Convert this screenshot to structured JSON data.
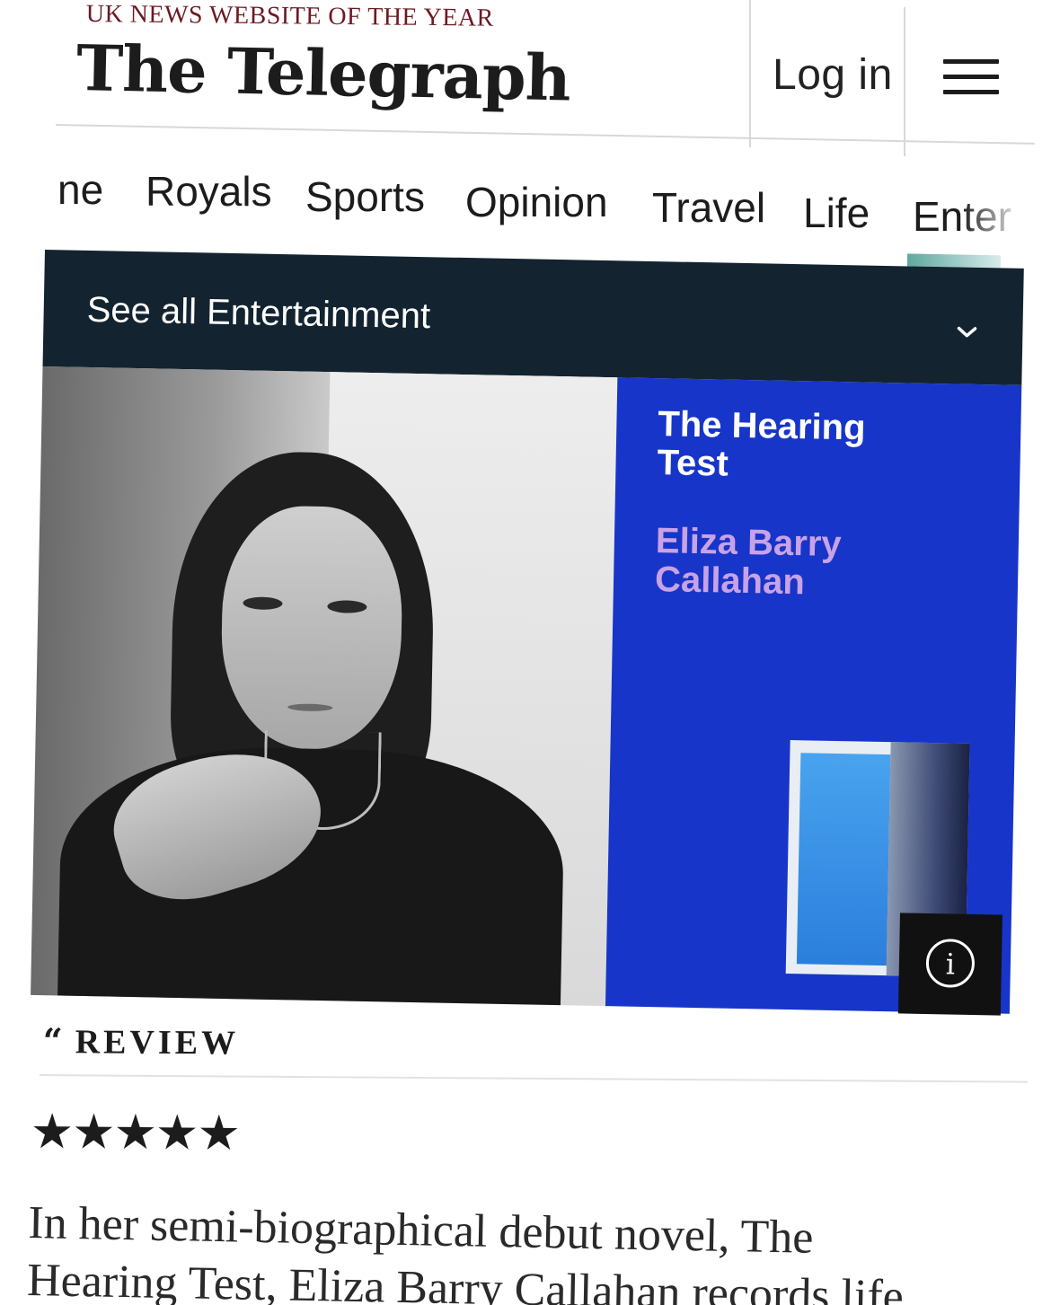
{
  "header": {
    "tagline": "UK NEWS WEBSITE OF THE YEAR",
    "logo": "The Telegraph",
    "login_label": "Log in",
    "menu_icon": "hamburger-menu-icon"
  },
  "nav": {
    "items": [
      "ne",
      "Royals",
      "Sports",
      "Opinion",
      "Travel",
      "Life",
      "Enter"
    ]
  },
  "section": {
    "see_all_label": "See all Entertainment",
    "chevron_icon": "chevron-down-icon"
  },
  "hero": {
    "book_title": "The Hearing Test",
    "book_author": "Eliza Barry Callahan",
    "book_bg_color": "#1735c9",
    "author_color": "#c9a2e6",
    "info_icon": "info-icon"
  },
  "review": {
    "quote_mark": "“",
    "label": "REVIEW",
    "stars": "★★★★★",
    "rating": 5,
    "lines": [
      "In her semi-biographical debut novel, The",
      "Hearing Test, Eliza Barry Callahan records life"
    ]
  }
}
